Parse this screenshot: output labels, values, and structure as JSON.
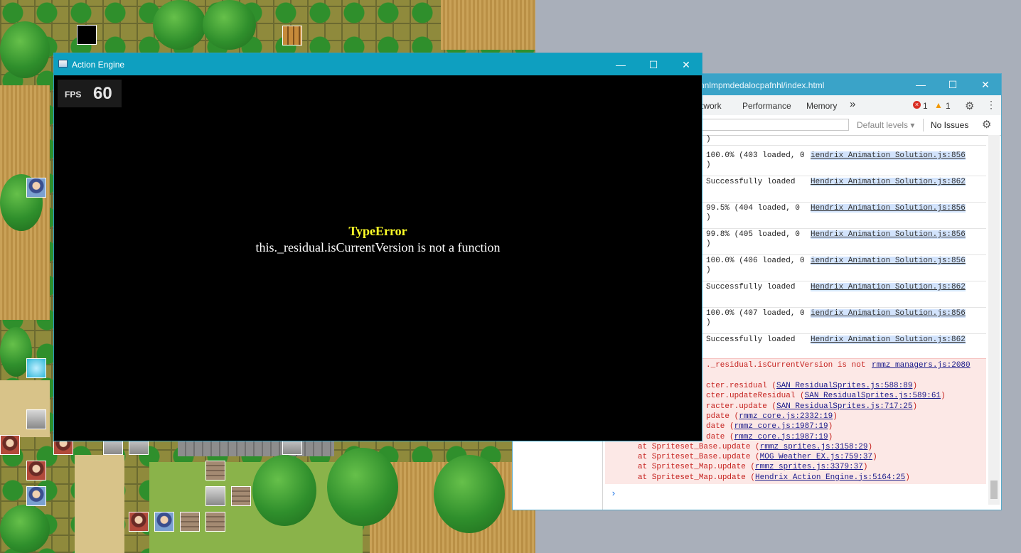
{
  "game_window": {
    "title": "Action Engine",
    "fps_label": "FPS",
    "fps_value": "60",
    "error_title": "TypeError",
    "error_message": "this._residual.isCurrentVersion is not a function",
    "minimize": "—",
    "maximize": "☐",
    "close": "✕"
  },
  "devtools": {
    "title": "nnlmpmdedalocpafnhl/index.html",
    "minimize": "—",
    "maximize": "☐",
    "close": "✕",
    "tabs": [
      "twork",
      "Performance",
      "Memory"
    ],
    "more_tabs": "»",
    "error_count": "1",
    "warning_count": "1",
    "levels_label": "Default levels ▾",
    "issues_label": "No Issues",
    "logs": [
      {
        "msg": "100.0% (403 loaded, 0",
        "src": "iendrix Animation Solution.js:856",
        "paren": ")"
      },
      {
        "msg": "Successfully loaded",
        "src": "Hendrix Animation Solution.js:862",
        "paren": ""
      },
      {
        "msg": "99.5% (404 loaded, 0",
        "src": "Hendrix Animation Solution.js:856",
        "paren": ")"
      },
      {
        "msg": "99.8% (405 loaded, 0",
        "src": "Hendrix Animation Solution.js:856",
        "paren": ")"
      },
      {
        "msg": "100.0% (406 loaded, 0",
        "src": "iendrix Animation Solution.js:856",
        "paren": ")"
      },
      {
        "msg": "Successfully loaded",
        "src": "Hendrix Animation Solution.js:862",
        "paren": ""
      },
      {
        "msg": "100.0% (407 loaded, 0",
        "src": "iendrix Animation Solution.js:856",
        "paren": ")"
      },
      {
        "msg": "Successfully loaded",
        "src": "Hendrix Animation Solution.js:862",
        "paren": ""
      }
    ],
    "error_head": "._residual.isCurrentVersion is not",
    "error_head_src": "rmmz managers.js:2080",
    "stack": [
      {
        "text": "cter.residual (",
        "link": "SAN ResidualSprites.js:588:89"
      },
      {
        "text": "cter.updateResidual (",
        "link": "SAN ResidualSprites.js:589:61"
      },
      {
        "text": "racter.update (",
        "link": "SAN ResidualSprites.js:717:25"
      },
      {
        "text": "pdate (",
        "link": "rmmz core.js:2332:19"
      },
      {
        "text": "date (",
        "link": "rmmz core.js:1987:19"
      },
      {
        "text": "date (",
        "link": "rmmz core.js:1987:19"
      },
      {
        "text": "at Spriteset_Base.update (",
        "link": "rmmz sprites.js:3158:29"
      },
      {
        "text": "at Spriteset_Base.update (",
        "link": "MOG Weather EX.js:759:37"
      },
      {
        "text": "at Spriteset_Map.update (",
        "link": "rmmz sprites.js:3379:37"
      },
      {
        "text": "at Spriteset_Map.update (",
        "link": "Hendrix Action Engine.js:5164:25"
      }
    ],
    "prompt": "›"
  }
}
